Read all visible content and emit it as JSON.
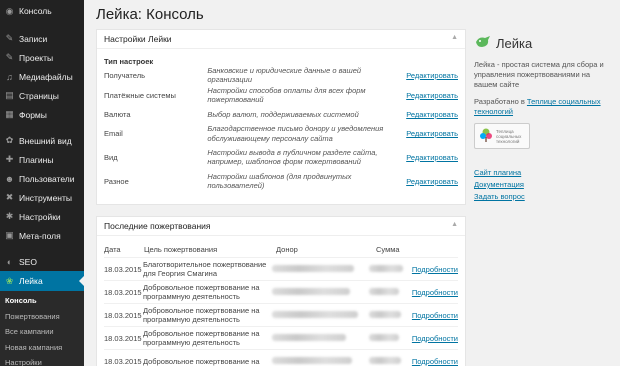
{
  "sidebar": {
    "items": [
      {
        "label": "Консоль",
        "icon": "dashboard-icon",
        "glyph": "◉"
      },
      {
        "label": "Записи",
        "icon": "pin-icon",
        "glyph": "✎"
      },
      {
        "label": "Проекты",
        "icon": "pin-icon",
        "glyph": "✎"
      },
      {
        "label": "Медиафайлы",
        "icon": "media-icon",
        "glyph": "♫"
      },
      {
        "label": "Страницы",
        "icon": "page-icon",
        "glyph": "▤"
      },
      {
        "label": "Формы",
        "icon": "forms-icon",
        "glyph": "▦"
      },
      {
        "label": "Внешний вид",
        "icon": "appearance-icon",
        "glyph": "✿"
      },
      {
        "label": "Плагины",
        "icon": "plugin-icon",
        "glyph": "✚"
      },
      {
        "label": "Пользователи",
        "icon": "users-icon",
        "glyph": "☻"
      },
      {
        "label": "Инструменты",
        "icon": "tools-icon",
        "glyph": "✖"
      },
      {
        "label": "Настройки",
        "icon": "settings-icon",
        "glyph": "✱"
      },
      {
        "label": "Мета-поля",
        "icon": "meta-icon",
        "glyph": "▣"
      },
      {
        "label": "SEO",
        "icon": "seo-icon",
        "glyph": "◐"
      },
      {
        "label": "Лейка",
        "icon": "leyka-icon",
        "glyph": "❀"
      }
    ],
    "submenu": [
      "Консоль",
      "Пожертвования",
      "Все кампании",
      "Новая кампания",
      "Настройки"
    ]
  },
  "page": {
    "title": "Лейка: Консоль"
  },
  "settings": {
    "title": "Настройки Лейки",
    "type_header": "Тип настроек",
    "rows": [
      {
        "name": "Получатель",
        "desc": "Банковские и юридические данные о вашей организации",
        "action": "Редактировать"
      },
      {
        "name": "Платёжные системы",
        "desc": "Настройки способов оплаты для всех форм пожертвований",
        "action": "Редактировать"
      },
      {
        "name": "Валюта",
        "desc": "Выбор валют, поддерживаемых системой",
        "action": "Редактировать"
      },
      {
        "name": "Email",
        "desc": "Благодарственное письмо донору и уведомления обслуживающему персоналу сайта",
        "action": "Редактировать"
      },
      {
        "name": "Вид",
        "desc": "Настройки вывода в публичном разделе сайта, например, шаблонов форм пожертвований",
        "action": "Редактировать"
      },
      {
        "name": "Разное",
        "desc": "Настройки шаблонов (для продвинутых пользователей)",
        "action": "Редактировать"
      }
    ]
  },
  "donations": {
    "title": "Последние пожертвования",
    "headers": [
      "Дата",
      "Цель пожертвования",
      "Донор",
      "Сумма"
    ],
    "rows": [
      {
        "date": "18.03.2015",
        "purpose": "Благотворительное пожертвование для Георгия Смагина",
        "action": "Подробности"
      },
      {
        "date": "18.03.2015",
        "purpose": "Добровольное пожертвование на программную деятельность",
        "action": "Подробности"
      },
      {
        "date": "18.03.2015",
        "purpose": "Добровольное пожертвование на программную деятельность",
        "action": "Подробности"
      },
      {
        "date": "18.03.2015",
        "purpose": "Добровольное пожертвование на программную деятельность",
        "action": "Подробности"
      },
      {
        "date": "18.03.2015",
        "purpose": "Добровольное пожертвование на",
        "action": "Подробности"
      }
    ]
  },
  "right": {
    "brand": "Лейка",
    "description": "Лейка - простая система для сбора и управления пожертвованиями на вашем сайте",
    "developed_prefix": "Разработано в ",
    "developed_link": "Теплице социальных технологий",
    "badge_text": "Теплица социальных технологий",
    "links": [
      "Сайт плагина",
      "Документация",
      "Задать вопрос"
    ]
  },
  "colors": {
    "accent": "#0074a2",
    "sidebar": "#222222",
    "brand_green": "#5cb85c"
  }
}
